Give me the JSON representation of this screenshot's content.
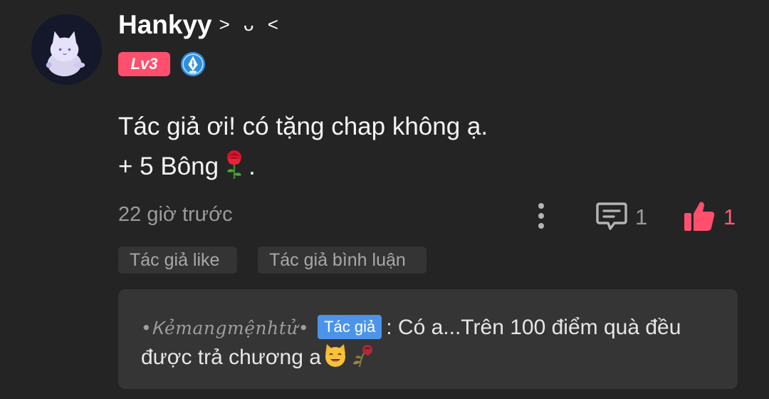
{
  "user": {
    "name": "Hankyy",
    "name_decoration": "> ᴗ <",
    "level": "Lv3"
  },
  "comment": {
    "line1": "Tác giả ơi! có tặng chap không ạ.",
    "line2_prefix": "+ 5 Bông",
    "line2_suffix": ".",
    "timestamp": "22 giờ trước",
    "reply_count": "1",
    "like_count": "1"
  },
  "chips": {
    "author_liked": "Tác giả like",
    "author_commented": "Tác giả bình luận"
  },
  "reply": {
    "author": "•Ꮶẻmangmệnhtử•",
    "author_tag": "Tác giả",
    "line1_text": ": Có a...Trên 100 điểm quà đều",
    "line2_text": "được trả chương a"
  },
  "icons": {
    "avatar": "cat-avatar",
    "badge": "pen-nib-badge",
    "comment_emoji": "rose-icon",
    "more": "more-vertical-icon",
    "reply": "comment-icon",
    "like": "thumbs-up-icon",
    "reply_emoji_1": "cat-face-icon",
    "reply_emoji_2": "wilted-flower-icon"
  },
  "colors": {
    "background": "#242424",
    "level_badge": "#ff4f6d",
    "like_accent": "#ff5c7a",
    "author_tag": "#4d94e8",
    "muted_text": "#9b9b9b"
  }
}
